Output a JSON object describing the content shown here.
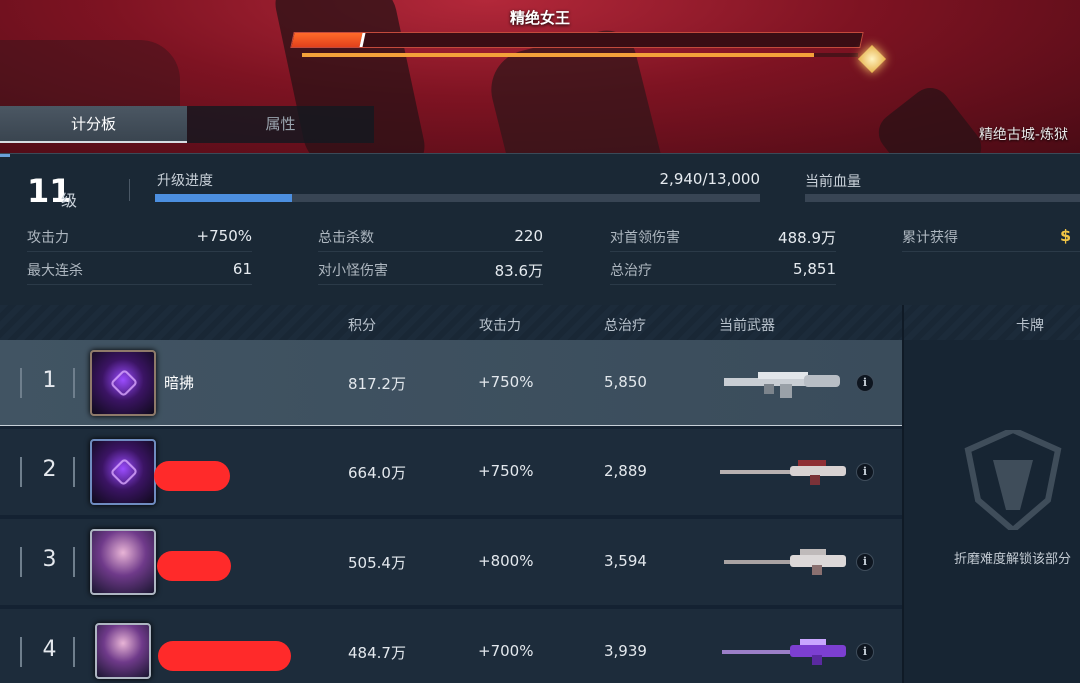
{
  "boss": {
    "name": "精绝女王",
    "hp_fraction": 0.12,
    "sub_fraction": 0.92
  },
  "location": "精绝古城-炼狱",
  "tabs": [
    {
      "label": "计分板",
      "active": true
    },
    {
      "label": "属性",
      "active": false
    }
  ],
  "player": {
    "level": "11",
    "level_unit": "级",
    "xp_label": "升级进度",
    "xp_text": "2,940/13,000",
    "xp_fraction": 0.226,
    "hp_label": "当前血量"
  },
  "stats": [
    {
      "label": "攻击力",
      "value": "+750%"
    },
    {
      "label": "总击杀数",
      "value": "220"
    },
    {
      "label": "对首领伤害",
      "value": "488.9万"
    },
    {
      "label": "累计获得",
      "value": "",
      "icon": "$"
    },
    {
      "label": "最大连杀",
      "value": "61"
    },
    {
      "label": "对小怪伤害",
      "value": "83.6万"
    },
    {
      "label": "总治疗",
      "value": "5,851"
    }
  ],
  "columns": {
    "score": "积分",
    "attack": "攻击力",
    "heal": "总治疗",
    "weapon": "当前武器",
    "cards": "卡牌"
  },
  "rows": [
    {
      "rank": "1",
      "name": "暗拂",
      "score": "817.2万",
      "attack": "+750%",
      "heal": "5,850",
      "weapon": "gatling-rifle",
      "redacted": false
    },
    {
      "rank": "2",
      "name": "",
      "score": "664.0万",
      "attack": "+750%",
      "heal": "2,889",
      "weapon": "sniper-rifle-red",
      "redacted": true
    },
    {
      "rank": "3",
      "name": "",
      "score": "505.4万",
      "attack": "+800%",
      "heal": "3,594",
      "weapon": "sniper-rifle-white",
      "redacted": true
    },
    {
      "rank": "4",
      "name": "",
      "score": "484.7万",
      "attack": "+700%",
      "heal": "3,939",
      "weapon": "sniper-rifle-purple",
      "redacted": true
    }
  ],
  "cards_locked_text": "折磨难度解锁该部分",
  "colors": {
    "accent_blue": "#4c8fe0",
    "boss_hp": "#e2401c",
    "redaction": "#ff2a2a"
  }
}
